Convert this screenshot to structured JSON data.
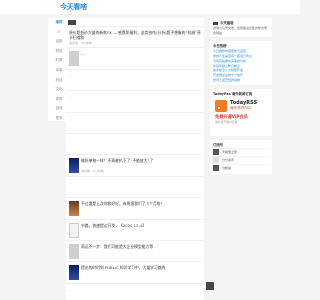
{
  "header": {
    "logo_text": "今天看啥"
  },
  "nav": {
    "items": [
      "推荐",
      "IT",
      "创投",
      "财经",
      "时政",
      "军事",
      "科技",
      "文化",
      "体育",
      "游戏",
      "更多"
    ]
  },
  "feed": {
    "entries": [
      {
        "title": "原价超低价大量的新款FX — 感恩发福利，这类创作(分析)超乎想象的“机械”亮卡扫描和",
        "source": "信息站",
        "time": "5分钟前",
        "kind": "text"
      },
      {
        "title": "…",
        "source": "",
        "time": "",
        "kind": "thumb",
        "thumb": "gray"
      },
      {
        "title": "…",
        "source": "",
        "time": "",
        "kind": "faded"
      },
      {
        "title": "…",
        "source": "",
        "time": "",
        "kind": "faded"
      },
      {
        "title": "…",
        "source": "",
        "time": "",
        "kind": "faded"
      },
      {
        "title": "…",
        "source": "",
        "time": "",
        "kind": "faded"
      },
      {
        "title": "做好单独一样！不再被扒下了“不能放大”了",
        "source": "中新网",
        "time": "3小时前",
        "kind": "thumb",
        "thumb": "blue"
      },
      {
        "title": "…",
        "source": "",
        "time": "",
        "kind": "faded"
      },
      {
        "title": "不过要是上次你和好好，有周报我们了 1个月啦！",
        "source": "",
        "time": "",
        "kind": "thumb",
        "thumb": "warm"
      },
      {
        "title": "中路，快速提议开发，【2020.12.4】",
        "source": "",
        "time": "",
        "kind": "thumb",
        "thumb": "face"
      },
      {
        "title": "再远不一步：我们可能是大企业模型能力等",
        "source": "",
        "time": "",
        "kind": "thumb",
        "thumb": "gray"
      },
      {
        "title": "提出的时时刻 PUBLIC 知识学习中，大量学习路线",
        "source": "",
        "time": "",
        "kind": "thumb",
        "thumb": "blue"
      },
      {
        "title": "…",
        "source": "",
        "time": "",
        "kind": "faded"
      }
    ]
  },
  "right": {
    "intro": {
      "head": "今天看啥",
      "text": "微信公众号文章，优质搬运合集的整合聚合网站"
    },
    "hot": {
      "head": "今日热榜",
      "links": [
        "今日推荐内容更新与运营",
        "你的人生是否有一座自己的山",
        "为何有些看似完美的分析",
        "新闻早报 | 昨日看点",
        "技术前沿 | 大模型开发",
        "开发者必读的十个技巧",
        "世界上最奇怪的动物"
      ]
    },
    "rss": {
      "head": "TodayRss 海外新闻订阅",
      "brand": "TodayRSS",
      "sub": "海外资讯RSS",
      "slogan": "免费开通VIP会员",
      "note": "海外资讯随时掌握"
    },
    "subs": {
      "head": "订阅号",
      "items": [
        "大模型之家",
        "分分资讯",
        "分析站"
      ]
    }
  }
}
